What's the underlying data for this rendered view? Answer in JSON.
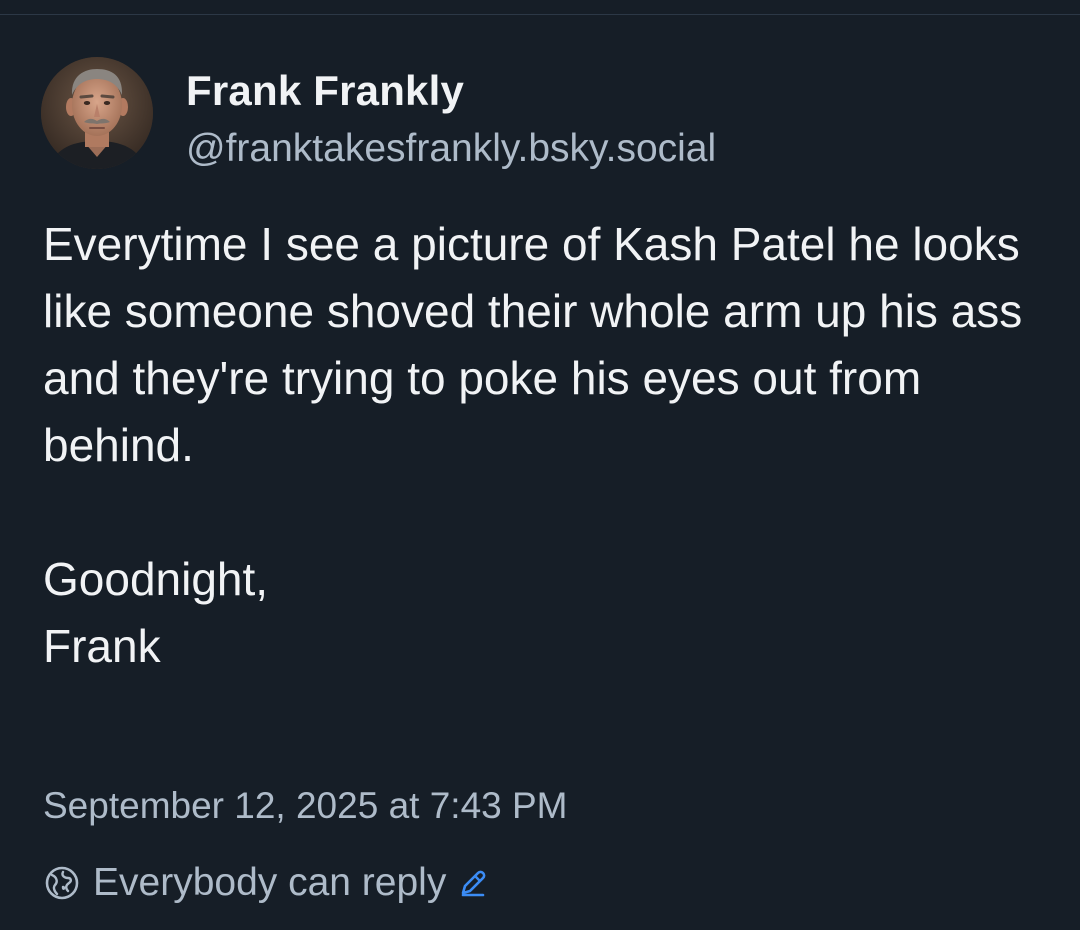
{
  "post": {
    "author": {
      "display_name": "Frank Frankly",
      "handle": "@franktakesfrankly.bsky.social"
    },
    "body_paragraphs": [
      "Everytime I see a picture of Kash Patel he looks like someone shoved their whole arm up his ass and they're trying to poke his eyes out from behind.",
      "Goodnight,",
      "Frank"
    ],
    "timestamp": "September 12, 2025 at 7:43 PM",
    "reply_setting": "Everybody can reply"
  },
  "icons": {
    "reply_setting": "globe-icon",
    "edit_reply_setting": "pencil-icon"
  },
  "colors": {
    "background": "#161e27",
    "primary_text": "#f1f3f5",
    "secondary_text": "#aebbc9",
    "accent": "#3b8cf5"
  }
}
